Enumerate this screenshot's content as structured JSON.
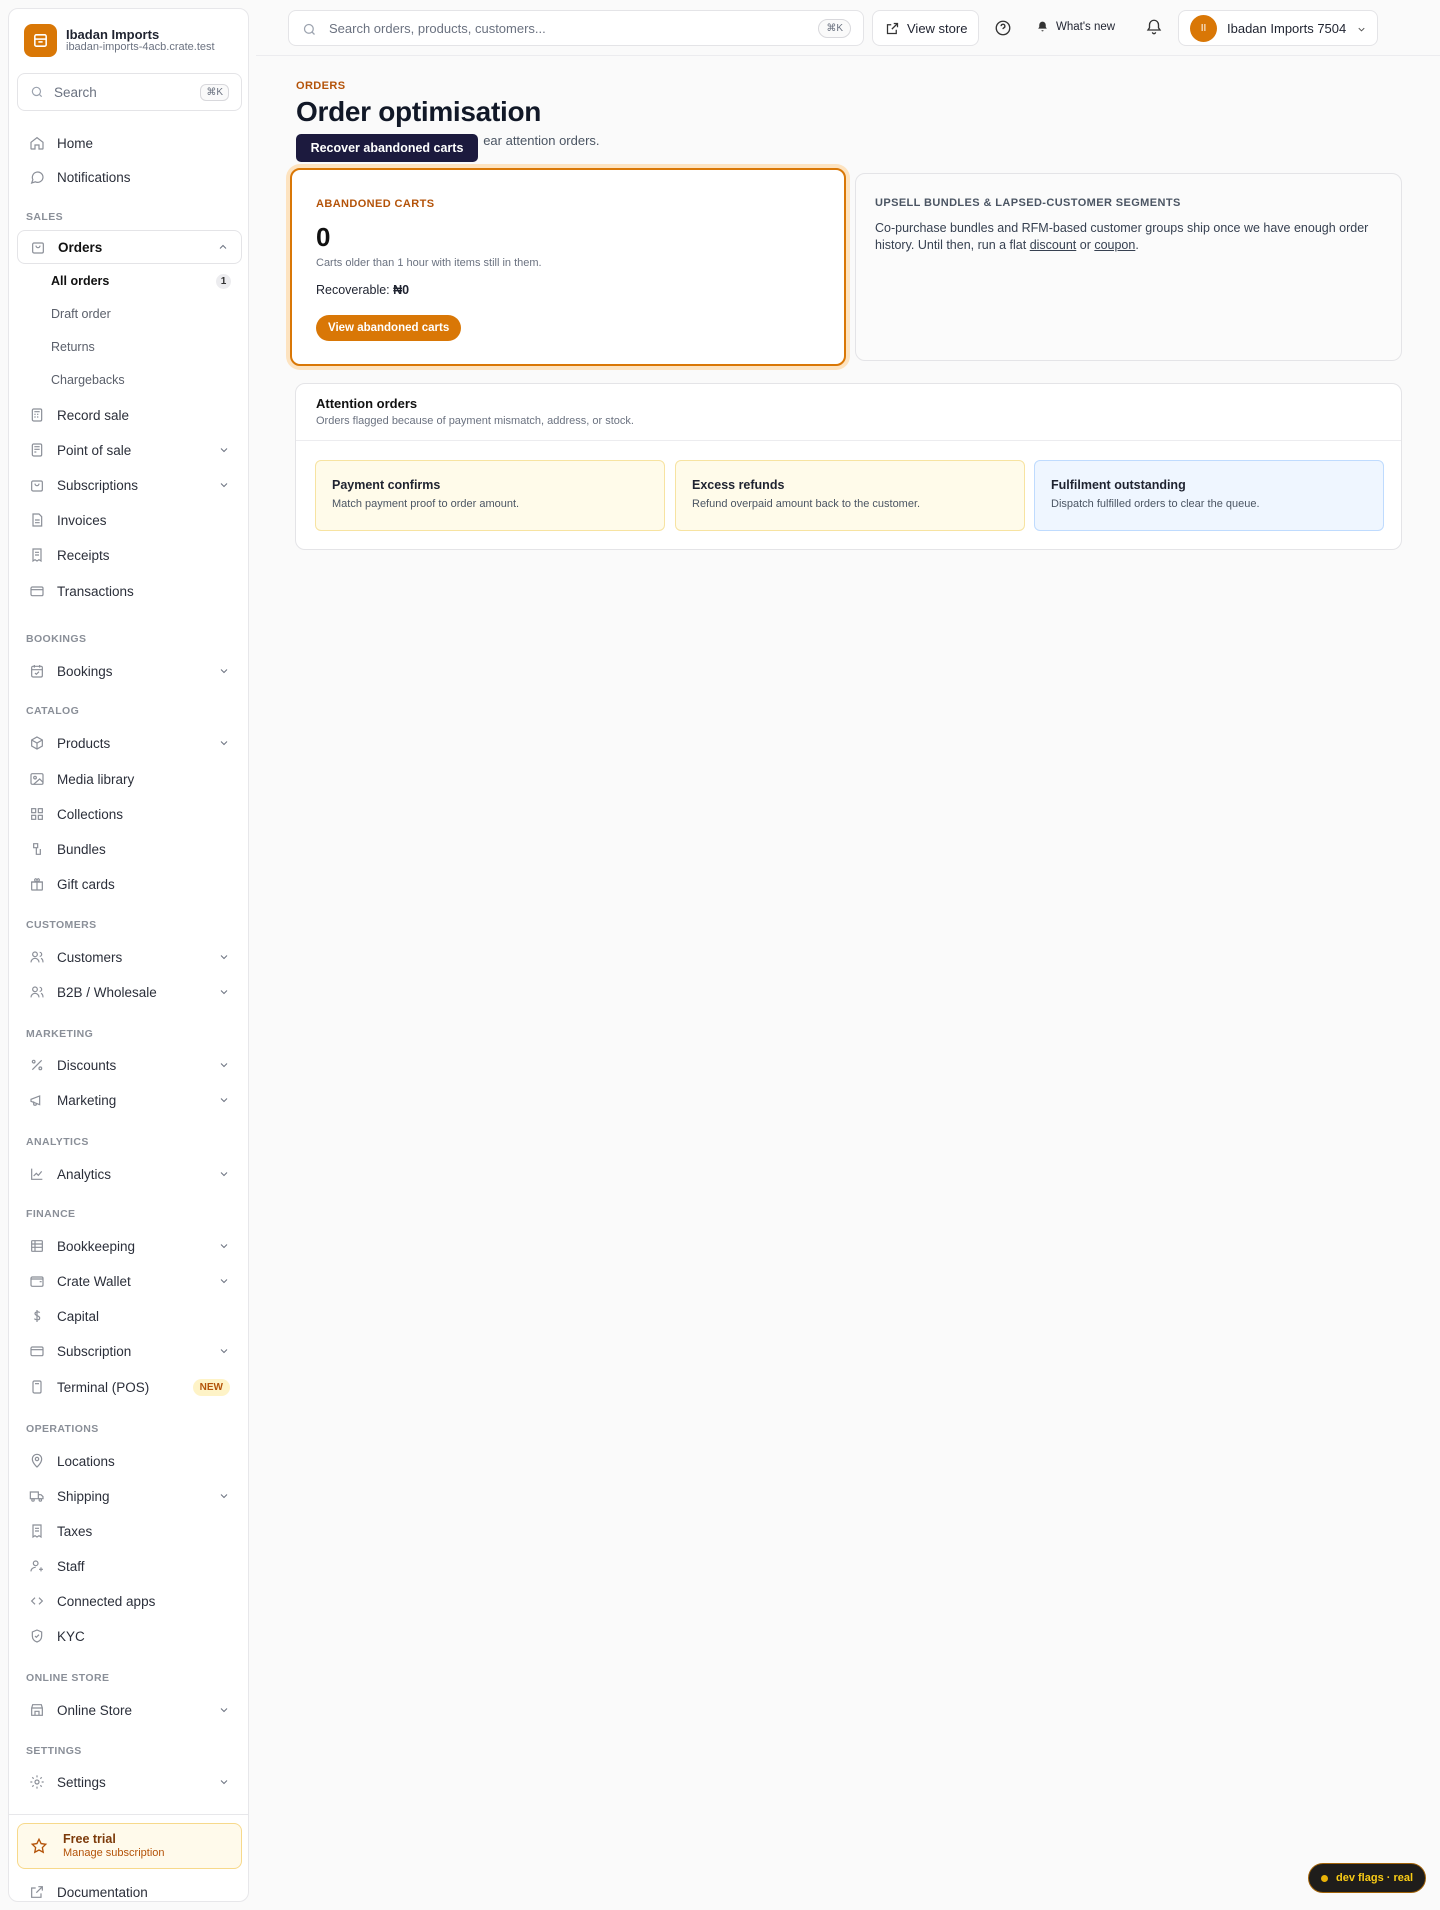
{
  "store": {
    "name": "Ibadan Imports",
    "domain": "ibadan-imports-4acb.crate.test"
  },
  "sidebar": {
    "search_label": "Search",
    "search_shortcut": "⌘K",
    "home": "Home",
    "notifications": "Notifications",
    "sections": {
      "sales": "SALES",
      "bookings": "BOOKINGS",
      "catalog": "CATALOG",
      "customers": "CUSTOMERS",
      "marketing": "MARKETING",
      "analytics": "ANALYTICS",
      "finance": "FINANCE",
      "operations": "OPERATIONS",
      "online_store": "ONLINE STORE",
      "settings": "SETTINGS"
    },
    "orders": "Orders",
    "orders_sub": {
      "all_orders": "All orders",
      "all_orders_count": "1",
      "draft_order": "Draft order",
      "returns": "Returns",
      "chargebacks": "Chargebacks"
    },
    "record_sale": "Record sale",
    "point_of_sale": "Point of sale",
    "subscriptions": "Subscriptions",
    "invoices": "Invoices",
    "receipts": "Receipts",
    "transactions": "Transactions",
    "bookings": "Bookings",
    "products": "Products",
    "media_library": "Media library",
    "collections": "Collections",
    "bundles": "Bundles",
    "gift_cards": "Gift cards",
    "customers": "Customers",
    "b2b": "B2B / Wholesale",
    "discounts": "Discounts",
    "marketing": "Marketing",
    "analytics": "Analytics",
    "bookkeeping": "Bookkeeping",
    "crate_wallet": "Crate Wallet",
    "capital": "Capital",
    "subscription": "Subscription",
    "terminal": "Terminal (POS)",
    "terminal_badge": "NEW",
    "locations": "Locations",
    "shipping": "Shipping",
    "taxes": "Taxes",
    "staff": "Staff",
    "connected_apps": "Connected apps",
    "kyc": "KYC",
    "online_store": "Online Store",
    "settings": "Settings",
    "trial_title": "Free trial",
    "trial_link": "Manage subscription",
    "documentation": "Documentation"
  },
  "topbar": {
    "search_placeholder": "Search orders, products, customers...",
    "search_shortcut": "⌘K",
    "view_store": "View store",
    "whats_new": "What's new",
    "account_initials": "II",
    "account_name": "Ibadan Imports 7504"
  },
  "page": {
    "eyebrow": "ORDERS",
    "title": "Order optimisation",
    "description_visible": "ear attention orders.",
    "tooltip": "Recover abandoned carts"
  },
  "abandoned": {
    "label": "ABANDONED CARTS",
    "count": "0",
    "note": "Carts older than 1 hour with items still in them.",
    "recoverable_label": "Recoverable:",
    "recoverable_value": "₦0",
    "button": "View abandoned carts"
  },
  "upsell": {
    "label": "UPSELL BUNDLES & LAPSED-CUSTOMER SEGMENTS",
    "text_before": "Co-purchase bundles and RFM-based customer groups ship once we have enough order history. Until then, run a flat ",
    "link_discount": "discount",
    "text_or": " or ",
    "link_coupon": "coupon",
    "text_end": "."
  },
  "attention": {
    "title": "Attention orders",
    "subtitle": "Orders flagged because of payment mismatch, address, or stock.",
    "tiles": [
      {
        "title": "Payment confirms",
        "desc": "Match payment proof to order amount."
      },
      {
        "title": "Excess refunds",
        "desc": "Refund overpaid amount back to the customer."
      },
      {
        "title": "Fulfilment outstanding",
        "desc": "Dispatch fulfilled orders to clear the queue."
      }
    ]
  },
  "dev_flags": "dev flags · real",
  "colors": {
    "accent": "#d97706",
    "tooltip_bg": "#1c1a3e",
    "warn_tile_bg": "#fffbea",
    "info_tile_bg": "#eff6ff"
  }
}
